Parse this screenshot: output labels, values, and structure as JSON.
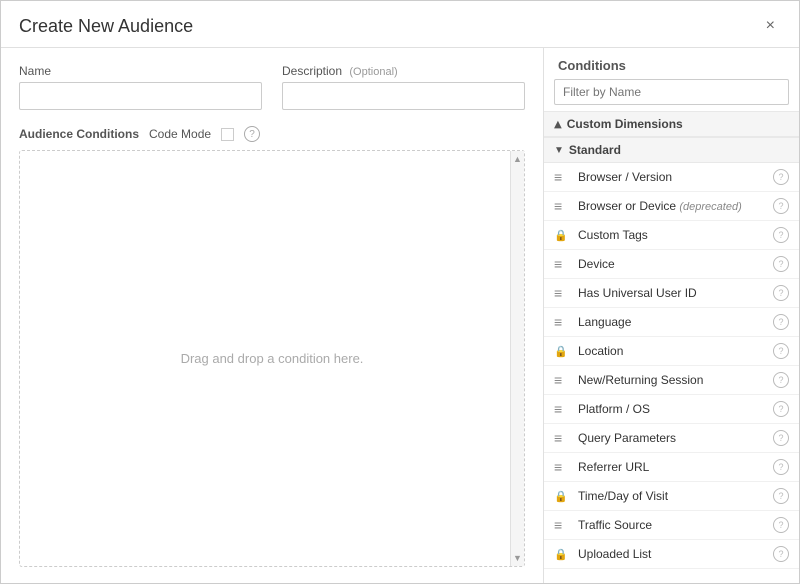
{
  "modal": {
    "title": "Create New Audience",
    "close_label": "×"
  },
  "form": {
    "name_label": "Name",
    "description_label": "Description",
    "description_optional": "(Optional)",
    "name_placeholder": "",
    "description_placeholder": ""
  },
  "audience_conditions": {
    "label": "Audience Conditions",
    "code_mode_label": "Code Mode",
    "drop_zone_text": "Drag and drop a condition here."
  },
  "conditions_panel": {
    "header": "Conditions",
    "filter_placeholder": "Filter by Name",
    "groups": [
      {
        "id": "custom-dimensions",
        "label": "Custom Dimensions",
        "collapsed": true,
        "items": []
      },
      {
        "id": "standard",
        "label": "Standard",
        "collapsed": false,
        "items": [
          {
            "id": "browser-version",
            "name": "Browser / Version",
            "icon": "lines",
            "deprecated": false
          },
          {
            "id": "browser-device",
            "name": "Browser or Device",
            "icon": "lines",
            "deprecated": true,
            "deprecated_text": "(deprecated)"
          },
          {
            "id": "custom-tags",
            "name": "Custom Tags",
            "icon": "lock",
            "deprecated": false
          },
          {
            "id": "device",
            "name": "Device",
            "icon": "lines",
            "deprecated": false
          },
          {
            "id": "has-universal-user-id",
            "name": "Has Universal User ID",
            "icon": "lines",
            "deprecated": false
          },
          {
            "id": "language",
            "name": "Language",
            "icon": "lines",
            "deprecated": false
          },
          {
            "id": "location",
            "name": "Location",
            "icon": "lock",
            "deprecated": false
          },
          {
            "id": "new-returning-session",
            "name": "New/Returning Session",
            "icon": "lines",
            "deprecated": false
          },
          {
            "id": "platform-os",
            "name": "Platform / OS",
            "icon": "lines",
            "deprecated": false
          },
          {
            "id": "query-parameters",
            "name": "Query Parameters",
            "icon": "lines",
            "deprecated": false
          },
          {
            "id": "referrer-url",
            "name": "Referrer URL",
            "icon": "lines",
            "deprecated": false
          },
          {
            "id": "time-day-of-visit",
            "name": "Time/Day of Visit",
            "icon": "lock",
            "deprecated": false
          },
          {
            "id": "traffic-source",
            "name": "Traffic Source",
            "icon": "lines",
            "deprecated": false
          },
          {
            "id": "uploaded-list",
            "name": "Uploaded List",
            "icon": "lock",
            "deprecated": false
          }
        ]
      }
    ]
  }
}
